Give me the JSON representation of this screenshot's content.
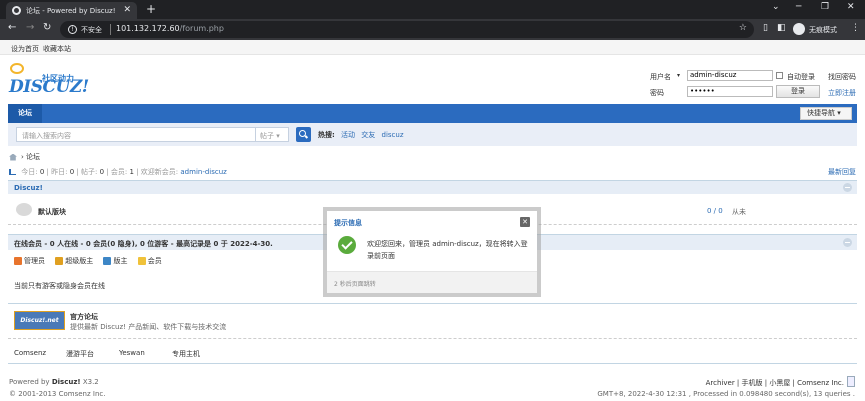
{
  "browser": {
    "tab_title": "论坛 - Powered by Discuz!",
    "insecure_label": "不安全",
    "url_host": "101.132.172.60",
    "url_path": "/forum.php",
    "incognito_label": "无痕模式"
  },
  "topnav": {
    "set_home": "设为首页",
    "bookmark": "收藏本站"
  },
  "logo": {
    "brand": "DISCUZ!",
    "slogan": "社区动力"
  },
  "login": {
    "username_label": "用户名",
    "username_value": "admin-discuz",
    "password_label": "密码",
    "password_value": "••••••",
    "auto_login": "自动登录",
    "find_password": "找回密码",
    "login_button": "登录",
    "register": "立即注册"
  },
  "nav": {
    "home": "论坛",
    "quick_nav": "快捷导航"
  },
  "search": {
    "placeholder": "请输入搜索内容",
    "type": "帖子",
    "hot_label": "热搜:",
    "hot_items": [
      "活动",
      "交友",
      "discuz"
    ]
  },
  "breadcrumb": {
    "current": "论坛"
  },
  "stats": {
    "today_label": "今日:",
    "today": "0",
    "yesterday_label": "昨日:",
    "yesterday": "0",
    "posts_label": "帖子:",
    "posts": "0",
    "members_label": "会员:",
    "members": "1",
    "welcome_label": "欢迎新会员:",
    "newest_member": "admin-discuz",
    "latest_reply": "最新回复"
  },
  "category": {
    "name": "Discuz!"
  },
  "forum": {
    "name": "默认版块",
    "count": "0 / 0",
    "last_post": "从未"
  },
  "online": {
    "title": "在线会员 - 0 人在线 - 0 会员(0 隐身), 0 位游客 - 最高记录是 0 于 2022-4-30.",
    "legend": [
      {
        "label": "管理员",
        "color": "#e8742c"
      },
      {
        "label": "超级版主",
        "color": "#e0a020"
      },
      {
        "label": "版主",
        "color": "#3d86c6"
      },
      {
        "label": "会员",
        "color": "#f0c23a"
      }
    ],
    "hidden_note": "当前只有游客或隐身会员在线"
  },
  "friends": {
    "logo_text": "Discuz!.net",
    "name": "官方论坛",
    "desc": "提供最新 Discuz! 产品新闻、软件下载与技术交流",
    "links": [
      "Comsenz",
      "漫游平台",
      "Yeswan",
      "专用主机"
    ]
  },
  "footer": {
    "powered": "Powered by",
    "product": "Discuz!",
    "version": "X3.2",
    "copyright": "© 2001-2013 Comsenz Inc.",
    "right_links": "Archiver | 手机版 | 小黑屋 | Comsenz Inc.",
    "runtime": "GMT+8, 2022-4-30 12:31 , Processed in 0.098480 second(s), 13 queries ."
  },
  "dialog": {
    "title": "提示信息",
    "message": "欢迎您回来，管理员 admin-discuz，现在将转入登录前页面",
    "redirect": "2 秒后页面跳转"
  }
}
